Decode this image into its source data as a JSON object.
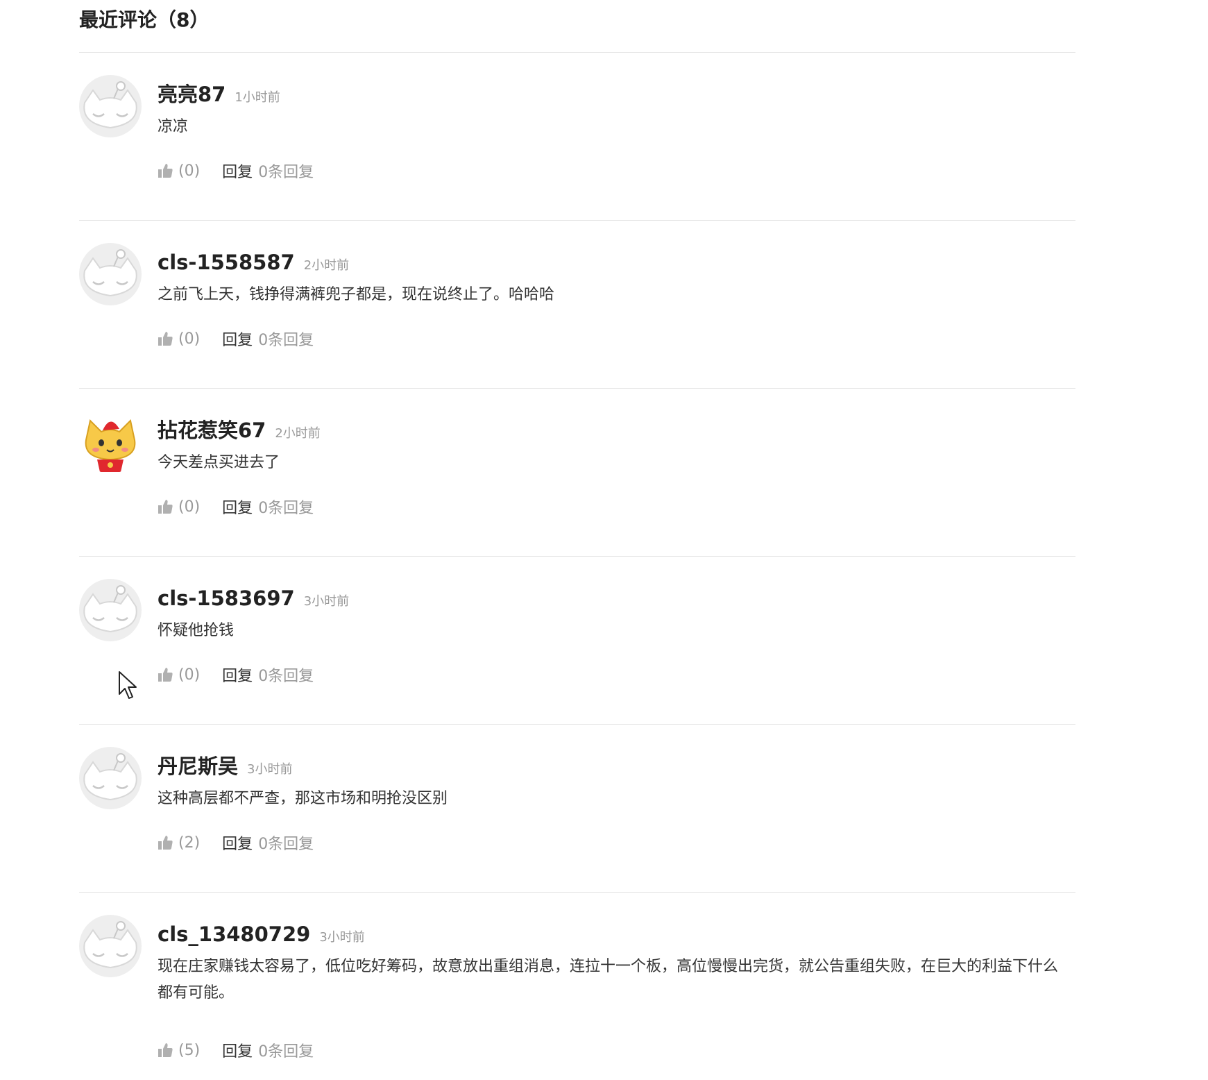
{
  "section": {
    "title": "最近评论（8）"
  },
  "comments": [
    {
      "username": "亮亮87",
      "time": "1小时前",
      "text": "凉凉",
      "likes": "(0)",
      "reply_label": "回复",
      "reply_count": "0条回复",
      "avatar": "default-cat-avatar-icon"
    },
    {
      "username": "cls-1558587",
      "time": "2小时前",
      "text": "之前飞上天，钱挣得满裤兜子都是，现在说终止了。哈哈哈",
      "likes": "(0)",
      "reply_label": "回复",
      "reply_count": "0条回复",
      "avatar": "default-cat-avatar-icon"
    },
    {
      "username": "拈花惹笑67",
      "time": "2小时前",
      "text": "今天差点买进去了",
      "likes": "(0)",
      "reply_label": "回复",
      "reply_count": "0条回复",
      "avatar": "yellow-cat-avatar-icon"
    },
    {
      "username": "cls-1583697",
      "time": "3小时前",
      "text": "怀疑他抢钱",
      "likes": "(0)",
      "reply_label": "回复",
      "reply_count": "0条回复",
      "avatar": "default-cat-avatar-icon"
    },
    {
      "username": "丹尼斯吴",
      "time": "3小时前",
      "text": "这种高层都不严查，那这市场和明抢没区别",
      "likes": "(2)",
      "reply_label": "回复",
      "reply_count": "0条回复",
      "avatar": "default-cat-avatar-icon"
    },
    {
      "username": "cls_13480729",
      "time": "3小时前",
      "text": "现在庄家赚钱太容易了，低位吃好筹码，故意放出重组消息，连拉十一个板，高位慢慢出完货，就公告重组失败，在巨大的利益下什么都有可能。",
      "likes": "(5)",
      "reply_label": "回复",
      "reply_count": "0条回复",
      "avatar": "default-cat-avatar-icon"
    }
  ],
  "colors": {
    "text_primary": "#222222",
    "text_muted": "#999999",
    "divider": "#e5e5e5",
    "avatar_bg": "#eeeeee",
    "avatar_yellow": "#f7c948",
    "avatar_red": "#e0282e"
  }
}
